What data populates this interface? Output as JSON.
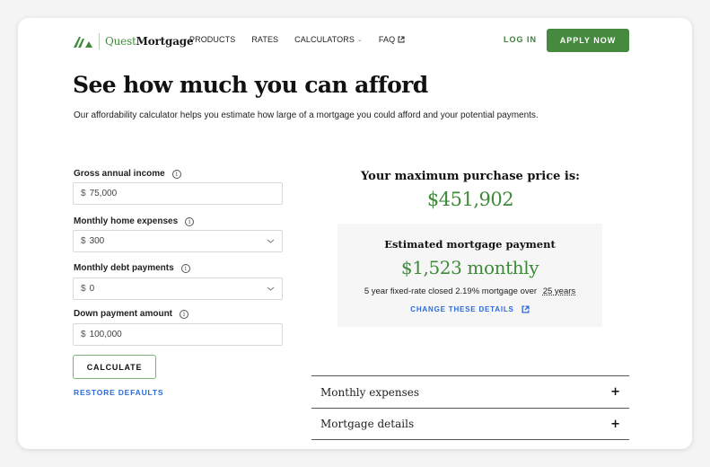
{
  "brand": {
    "name_prefix": "Quest",
    "name_suffix": "Mortgage",
    "accent_color": "#468a3f",
    "link_color": "#2e6bd6"
  },
  "nav": {
    "items": [
      {
        "label": "PRODUCTS"
      },
      {
        "label": "RATES"
      },
      {
        "label": "CALCULATORS",
        "icon": "chevron-down-icon"
      },
      {
        "label": "FAQ",
        "icon": "external-link-icon"
      }
    ],
    "login_label": "LOG IN",
    "apply_label": "APPLY NOW"
  },
  "page": {
    "title": "See how much you can afford",
    "intro": "Our affordability calculator helps you estimate how large of a mortgage you could afford and your potential payments."
  },
  "form": {
    "fields": [
      {
        "label": "Gross annual income",
        "currency": "$",
        "value": "75,000",
        "type": "text"
      },
      {
        "label": "Monthly home expenses",
        "currency": "$",
        "value": "300",
        "type": "select"
      },
      {
        "label": "Monthly debt payments",
        "currency": "$",
        "value": "0",
        "type": "select"
      },
      {
        "label": "Down payment amount",
        "currency": "$",
        "value": "100,000",
        "type": "text"
      }
    ],
    "calculate_label": "CALCULATE",
    "restore_label": "RESTORE DEFAULTS"
  },
  "results": {
    "max_label": "Your maximum purchase price is:",
    "max_value": "$451,902",
    "payment_title": "Estimated mortgage payment",
    "payment_value": "$1,523 monthly",
    "payment_desc": "5 year fixed-rate closed 2.19%  mortgage over",
    "payment_term": "25 years",
    "change_label": "CHANGE THESE DETAILS"
  },
  "accordion": [
    {
      "label": "Monthly expenses",
      "icon": "+"
    },
    {
      "label": "Mortgage details",
      "icon": "+"
    }
  ]
}
